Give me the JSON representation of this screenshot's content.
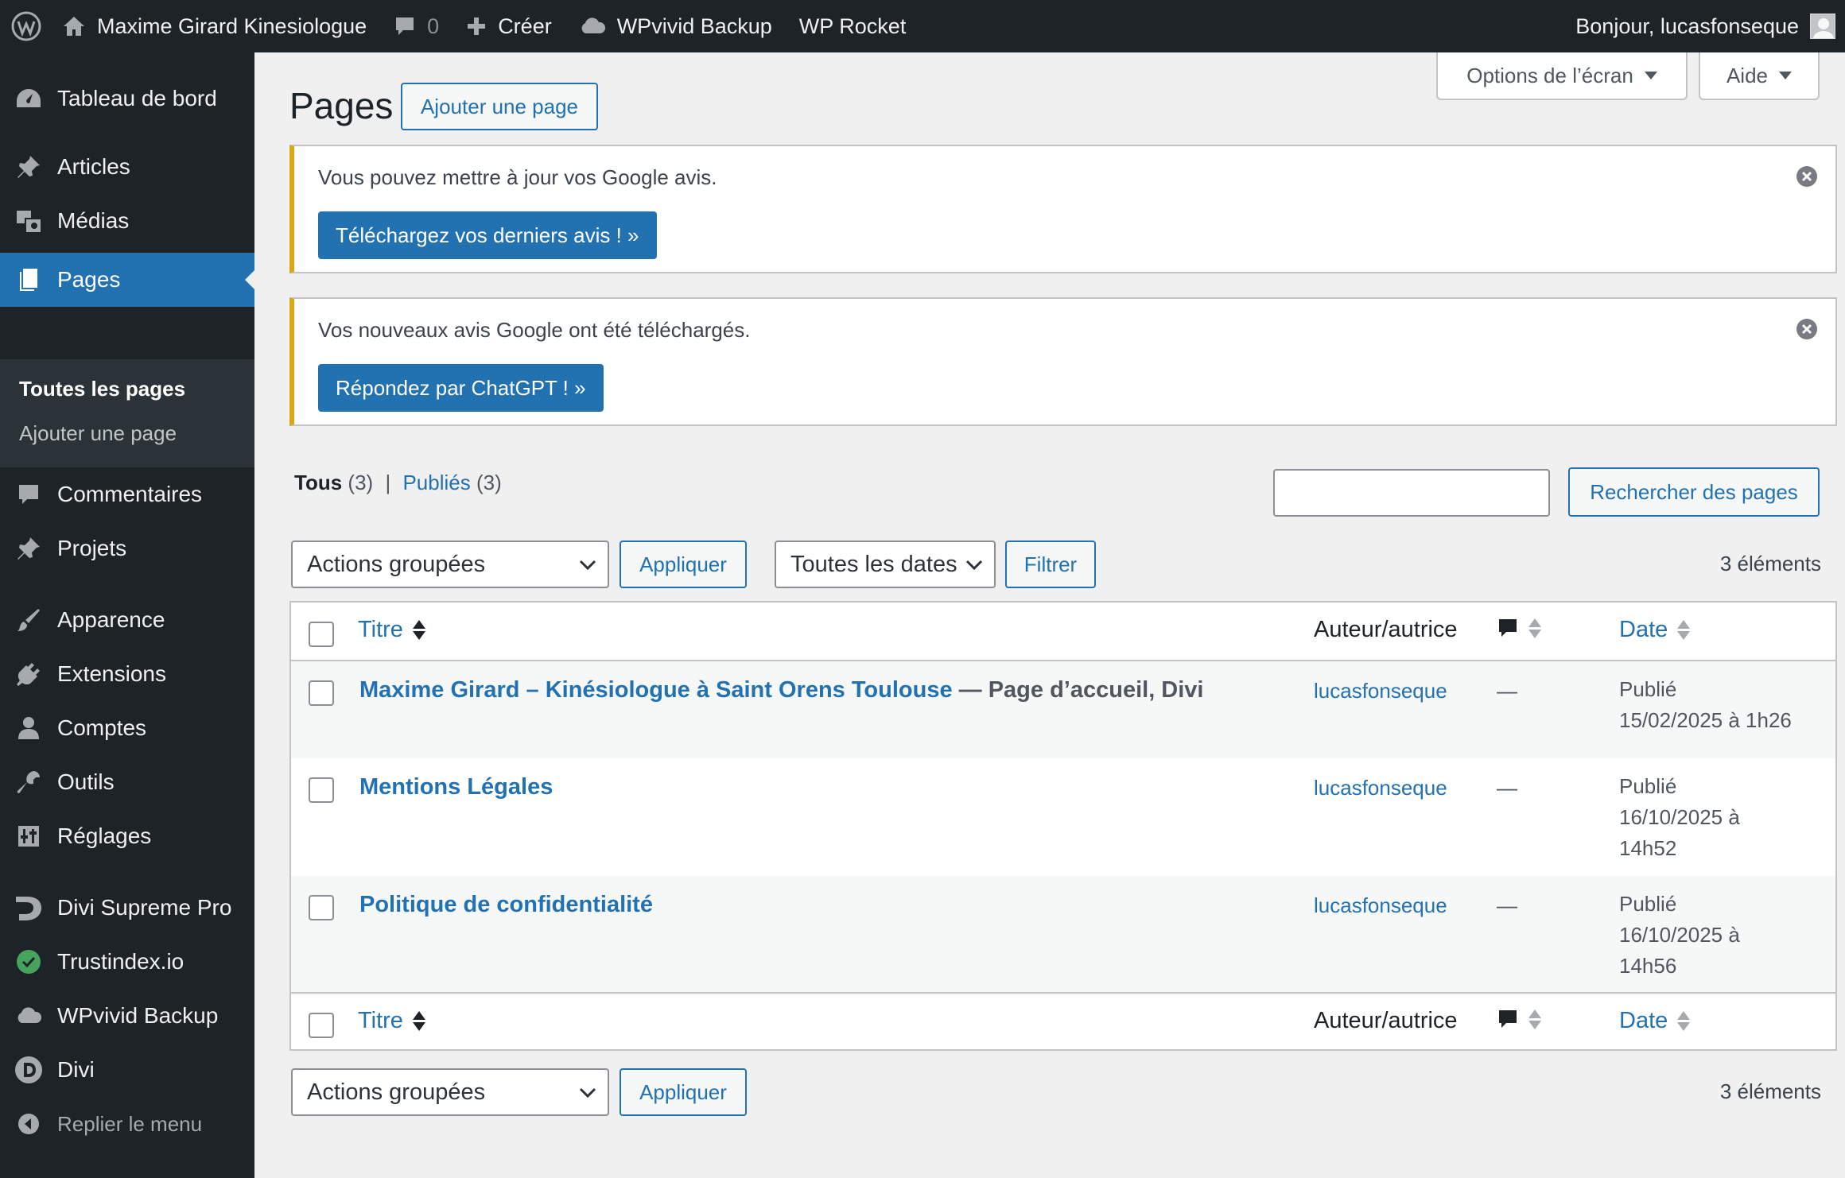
{
  "adminbar": {
    "site_name": "Maxime Girard Kinesiologue",
    "comments_count": "0",
    "new_label": "Créer",
    "backup_label": "WPvivid Backup",
    "rocket_label": "WP Rocket",
    "greeting": "Bonjour, lucasfonseque"
  },
  "sidebar": {
    "dashboard": "Tableau de bord",
    "posts": "Articles",
    "media": "Médias",
    "pages": "Pages",
    "pages_submenu": {
      "all": "Toutes les pages",
      "add": "Ajouter une page"
    },
    "comments": "Commentaires",
    "projects": "Projets",
    "appearance": "Apparence",
    "plugins": "Extensions",
    "users": "Comptes",
    "tools": "Outils",
    "settings": "Réglages",
    "divi_supreme": "Divi Supreme Pro",
    "trustindex": "Trustindex.io",
    "wpvivid": "WPvivid Backup",
    "divi": "Divi",
    "collapse": "Replier le menu"
  },
  "header": {
    "title": "Pages",
    "add_new": "Ajouter une page",
    "screen_options": "Options de l’écran",
    "help": "Aide"
  },
  "notices": [
    {
      "text": "Vous pouvez mettre à jour vos Google avis.",
      "button": "Téléchargez vos derniers avis ! »"
    },
    {
      "text": "Vos nouveaux avis Google ont été téléchargés.",
      "button": "Répondez par ChatGPT ! »"
    }
  ],
  "views": {
    "all_label": "Tous",
    "all_count": "(3)",
    "separator": "|",
    "published_label": "Publiés",
    "published_count": "(3)"
  },
  "search": {
    "value": "",
    "button": "Rechercher des pages"
  },
  "filters": {
    "bulk_actions": "Actions groupées",
    "apply": "Appliquer",
    "dates": "Toutes les dates",
    "filter": "Filtrer",
    "items_count": "3 éléments"
  },
  "table": {
    "columns": {
      "title": "Titre",
      "author": "Auteur/autrice",
      "date": "Date"
    },
    "rows": [
      {
        "title": "Maxime Girard – Kinésiologue à Saint Orens Toulouse",
        "state": " — Page d’accueil, Divi",
        "author": "lucasfonseque",
        "comments": "—",
        "status": "Publié",
        "date_line1": "15/02/2025 à 1h26",
        "date_line2": ""
      },
      {
        "title": "Mentions Légales",
        "state": "",
        "author": "lucasfonseque",
        "comments": "—",
        "status": "Publié",
        "date_line1": "16/10/2025 à",
        "date_line2": "14h52"
      },
      {
        "title": "Politique de confidentialité",
        "state": "",
        "author": "lucasfonseque",
        "comments": "—",
        "status": "Publié",
        "date_line1": "16/10/2025 à",
        "date_line2": "14h56"
      }
    ]
  },
  "colors": {
    "adminbar_bg": "#1d2327",
    "accent": "#2271b1",
    "notice_border": "#dba617"
  }
}
